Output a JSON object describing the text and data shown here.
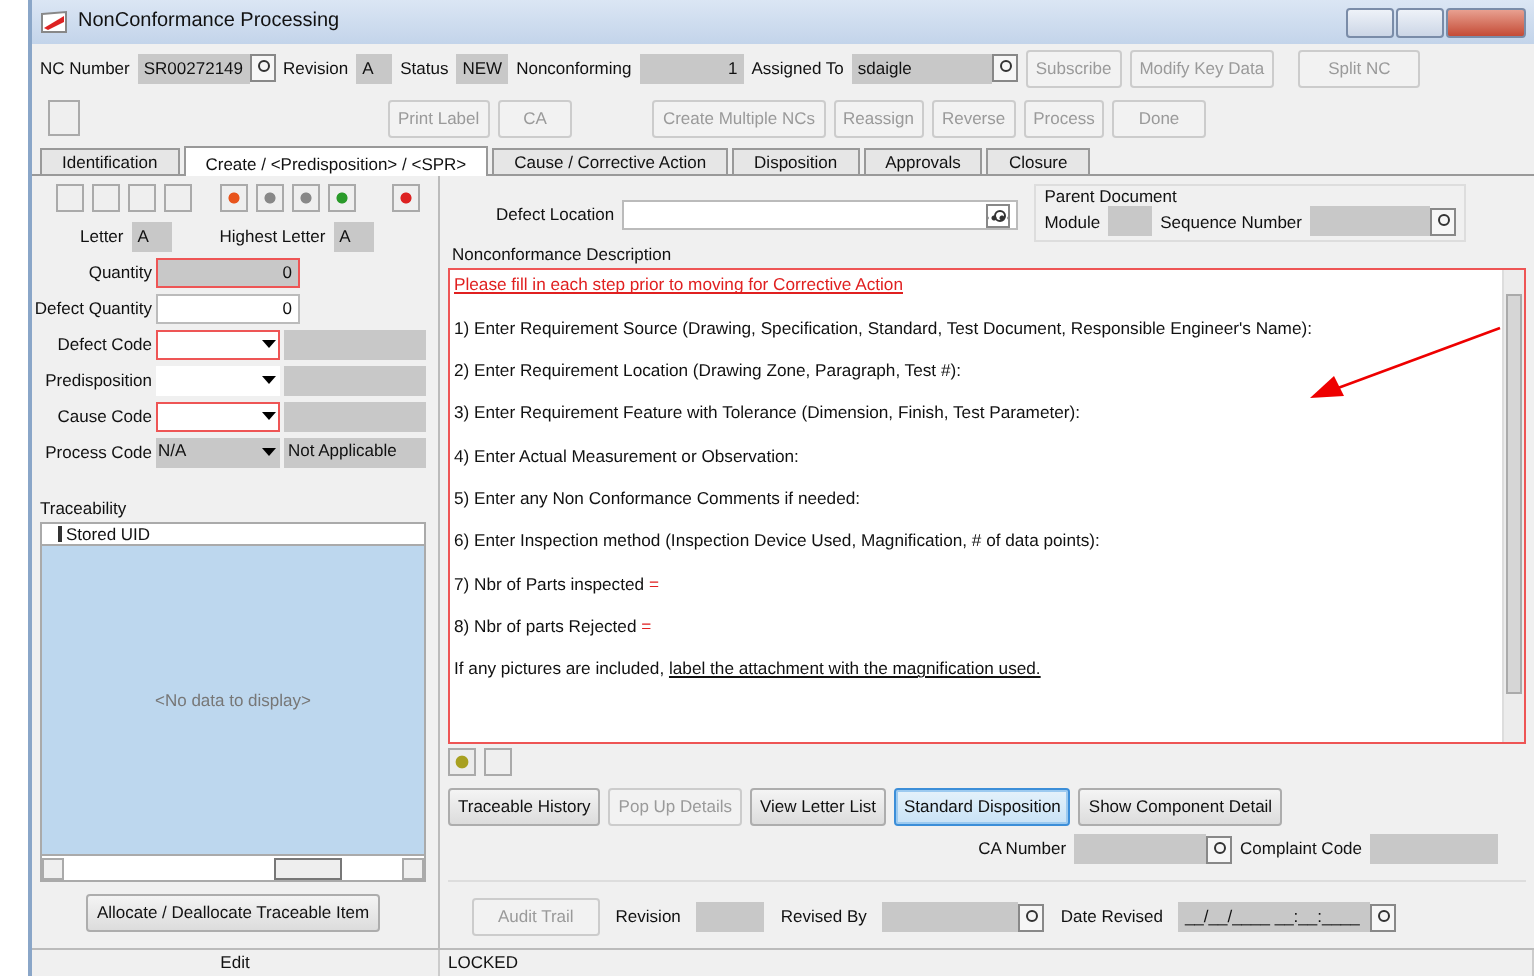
{
  "window": {
    "title": "NonConformance Processing"
  },
  "header_fields": [
    {
      "label": "NC Number",
      "value": "SR00272149",
      "kind": "lookup"
    },
    {
      "label": "Revision",
      "value": "A",
      "kind": "text"
    },
    {
      "label": "Status",
      "value": "NEW",
      "kind": "text"
    },
    {
      "label": "Nonconforming",
      "value": "1",
      "kind": "number"
    },
    {
      "label": "Assigned To",
      "value": "sdaigle",
      "kind": "lookup"
    }
  ],
  "header_buttons": [
    {
      "label": "Subscribe",
      "disabled": true
    },
    {
      "label": "Modify Key Data",
      "disabled": true
    },
    {
      "label": "Split NC",
      "disabled": true
    }
  ],
  "toolbar_buttons": [
    {
      "label": "Print Label",
      "disabled": true
    },
    {
      "label": "CA",
      "disabled": true
    },
    {
      "label": "Create Multiple NCs",
      "disabled": true
    },
    {
      "label": "Reassign",
      "disabled": true
    },
    {
      "label": "Reverse",
      "disabled": true
    },
    {
      "label": "Process",
      "disabled": true
    },
    {
      "label": "Done",
      "disabled": true
    }
  ],
  "tabs": [
    {
      "label": "Identification",
      "selected": false
    },
    {
      "label": "Create / <Predisposition> / <SPR>",
      "selected": true
    },
    {
      "label": "Cause / Corrective Action",
      "selected": false
    },
    {
      "label": "Disposition",
      "selected": false
    },
    {
      "label": "Approvals",
      "selected": false
    },
    {
      "label": "Closure",
      "selected": false
    }
  ],
  "letter": {
    "label": "Letter",
    "value": "A"
  },
  "highest_letter": {
    "label": "Highest Letter",
    "value": "A"
  },
  "form_rows": [
    {
      "label": "Quantity",
      "value": "0",
      "kind": "number",
      "required": true,
      "readonly": true
    },
    {
      "label": "Defect Quantity",
      "value": "0",
      "kind": "number",
      "required": false,
      "readonly": false
    },
    {
      "label": "Defect Code",
      "kind": "dropdown",
      "required": true
    },
    {
      "label": "Predisposition",
      "kind": "dropdown",
      "required": false
    },
    {
      "label": "Cause Code",
      "kind": "dropdown",
      "required": true
    },
    {
      "label": "Process Code",
      "value": "N/A",
      "description": "Not Applicable",
      "kind": "dropdown",
      "required": false
    }
  ],
  "traceability": {
    "title": "Traceability",
    "column": "Stored UID",
    "empty_text": "<No data to display>",
    "button": "Allocate / Deallocate Traceable Item"
  },
  "defect_location": {
    "label": "Defect Location"
  },
  "parent_document": {
    "title": "Parent Document",
    "module_label": "Module",
    "sequence_label": "Sequence Number"
  },
  "description": {
    "label": "Nonconformance Description",
    "lines": [
      [
        {
          "text": "Please fill in each step prior to moving for Corrective Action",
          "kind": "heading"
        }
      ],
      [
        {
          "text": "1) Enter Requirement Source (Drawing, Specification, Standard, Test Document, Responsible Engineer's Name):",
          "kind": "plain"
        }
      ],
      [
        {
          "text": "2) Enter Requirement Location (Drawing Zone, Paragraph, Test #):",
          "kind": "plain"
        }
      ],
      [
        {
          "text": "3) Enter Requirement Feature with Tolerance (Dimension, Finish, Test Parameter):",
          "kind": "plain"
        }
      ],
      [
        {
          "text": "4) Enter Actual Measurement or Observation:",
          "kind": "plain"
        }
      ],
      [
        {
          "text": "5) Enter any Non Conformance Comments if needed:",
          "kind": "plain"
        }
      ],
      [
        {
          "text": "6) Enter Inspection method (Inspection Device Used, Magnification, # of data points):",
          "kind": "plain"
        }
      ],
      [
        {
          "text": "7) Nbr of Parts inspected",
          "kind": "plain"
        },
        {
          "text": "=",
          "kind": "answer"
        }
      ],
      [
        {
          "text": "8) Nbr of parts Rejected",
          "kind": "plain"
        },
        {
          "text": "=",
          "kind": "answer"
        }
      ],
      [
        {
          "text": "If any pictures are included,",
          "kind": "plain"
        },
        {
          "text": "label the attachment with the magnification used.",
          "kind": "link"
        }
      ]
    ]
  },
  "action_buttons": [
    {
      "label": "Traceable History",
      "disabled": false,
      "focused": false
    },
    {
      "label": "Pop Up Details",
      "disabled": true,
      "focused": false
    },
    {
      "label": "View Letter List",
      "disabled": false,
      "focused": false
    },
    {
      "label": "Standard Disposition",
      "disabled": false,
      "focused": true
    },
    {
      "label": "Show Component Detail",
      "disabled": false,
      "focused": false
    }
  ],
  "ca_number": {
    "label": "CA Number"
  },
  "complaint_code": {
    "label": "Complaint Code"
  },
  "audit": {
    "button": "Audit Trail",
    "button_disabled": true,
    "revision_label": "Revision",
    "revised_by_label": "Revised By",
    "date_label": "Date Revised",
    "date_value": "__/__/____ __:__:____"
  },
  "status_bar": [
    "Edit",
    "LOCKED"
  ]
}
